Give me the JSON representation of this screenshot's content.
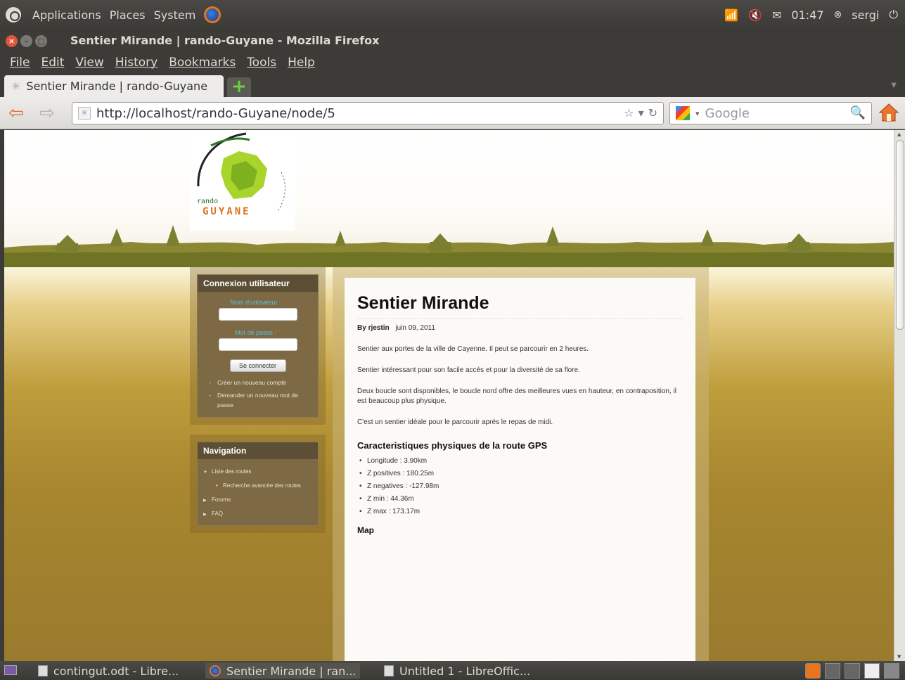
{
  "top_panel": {
    "menus": [
      "Applications",
      "Places",
      "System"
    ],
    "time": "01:47",
    "user": "sergi"
  },
  "window": {
    "title": "Sentier Mirande | rando-Guyane - Mozilla Firefox"
  },
  "menubar": [
    "File",
    "Edit",
    "View",
    "History",
    "Bookmarks",
    "Tools",
    "Help"
  ],
  "tab": {
    "title": "Sentier Mirande | rando-Guyane",
    "new_tab": "+"
  },
  "navbar": {
    "url": "http://localhost/rando-Guyane/node/5",
    "search_placeholder": "Google"
  },
  "logo": {
    "top": "rando",
    "bottom": "GUYANE"
  },
  "login_block": {
    "title": "Connexion utilisateur",
    "username_label": "Nom d'utilisateur :",
    "password_label": "Mot de passe :",
    "required_mark": "*",
    "submit": "Se connecter",
    "links": [
      "Créer un nouveau compte",
      "Demander un nouveau mot de passe"
    ]
  },
  "nav_block": {
    "title": "Navigation",
    "items": [
      {
        "label": "Liste des routes"
      },
      {
        "label": "Recherche avancée des routes"
      },
      {
        "label": "Forums"
      },
      {
        "label": "FAQ"
      }
    ]
  },
  "article": {
    "title": "Sentier Mirande",
    "author_prefix": "By",
    "author": "rjestin",
    "date": "juin 09, 2011",
    "paragraphs": [
      "Sentier aux portes de la ville de Cayenne. Il peut se parcourir en 2 heures.",
      "Sentier intéressant pour son facile accés et pour la diversité de sa flore.",
      "Deux boucle sont disponibles, le boucle nord offre des meilleures vues en hauteur, en contraposition, il est beaucoup plus physique.",
      "C'est un sentier idéale pour le parcourir aprés le repas de midi."
    ],
    "section_title": "Caracteristiques physiques de la route GPS",
    "specs": [
      "Longitude : 3.90km",
      "Z positives : 180.25m",
      "Z negatives : -127.98m",
      "Z min : 44.36m",
      "Z max : 173.17m"
    ],
    "map_title": "Map"
  },
  "taskbar": {
    "items": [
      "contingut.odt - Libre...",
      "Sentier Mirande | ran...",
      "Untitled 1 - LibreOffic..."
    ]
  },
  "colors": {
    "accent": "#e86a2c",
    "page_bg": "#a0832e",
    "block_header": "#5d4f36"
  }
}
